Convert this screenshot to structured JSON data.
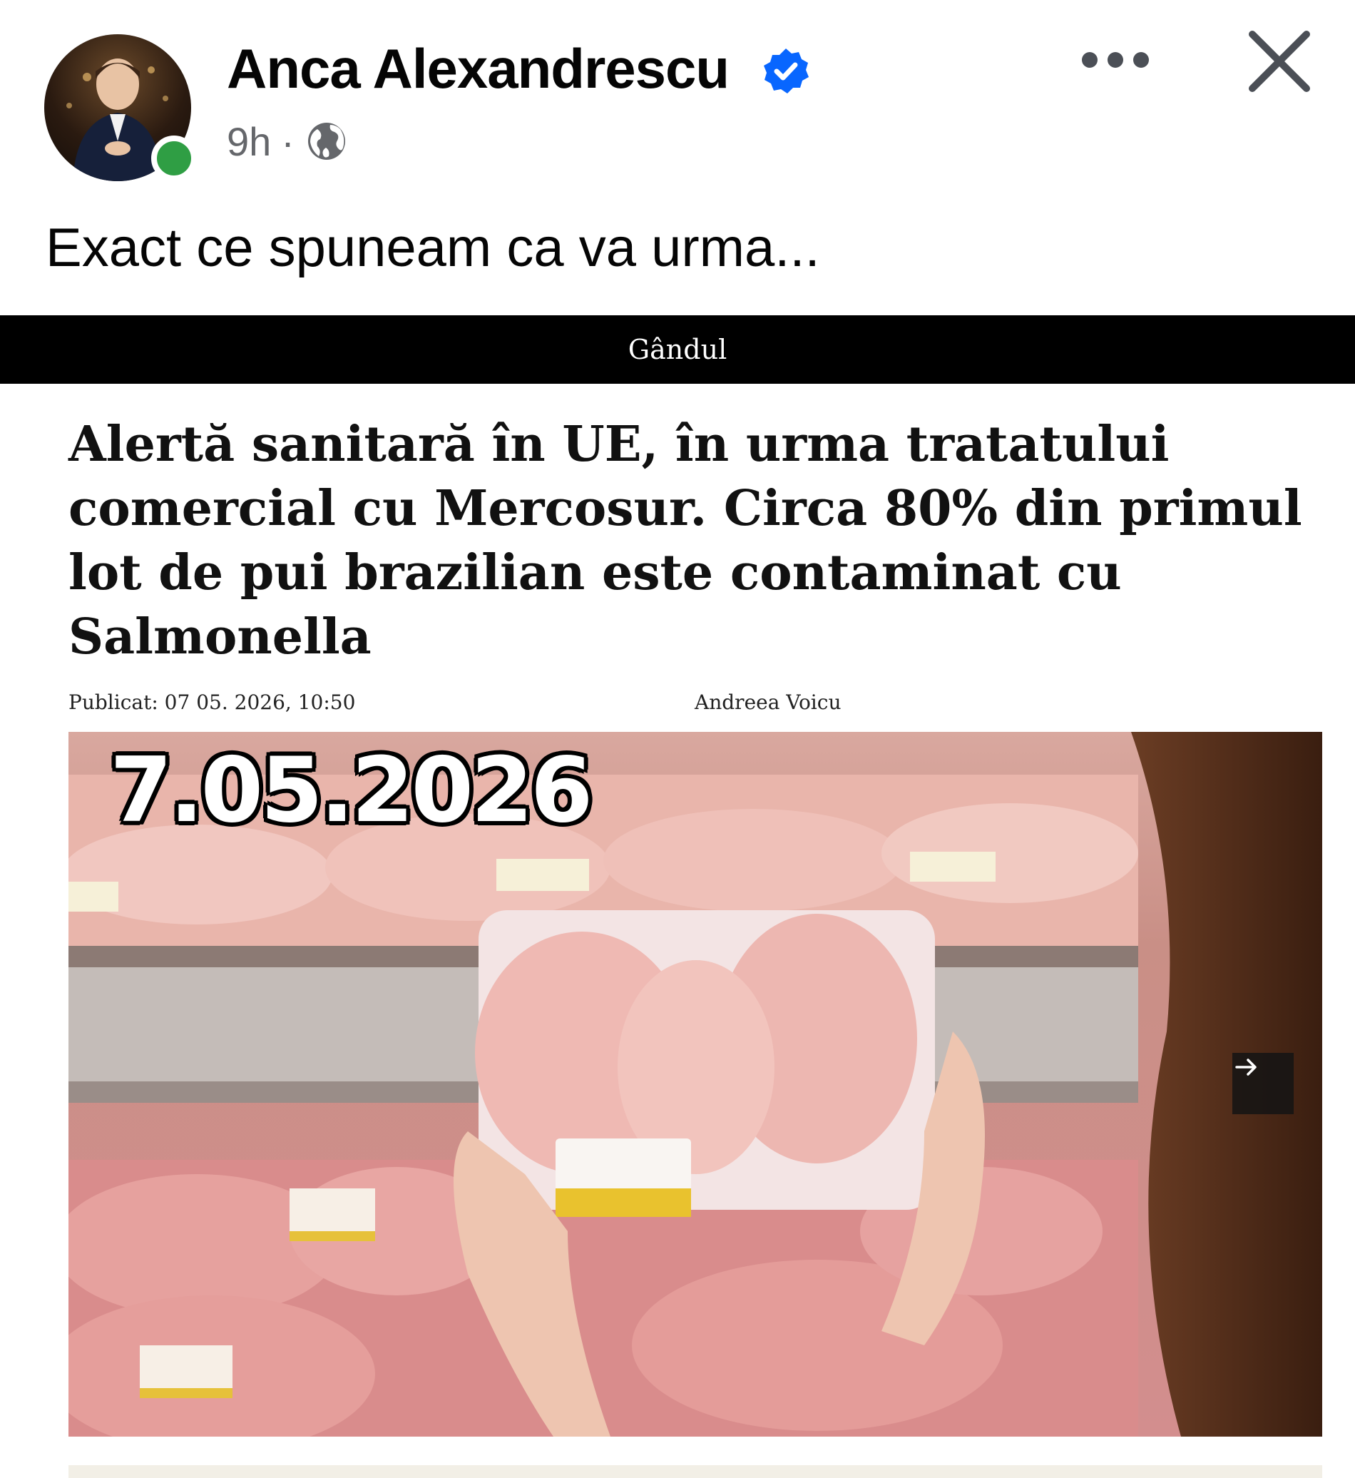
{
  "post": {
    "author_name": "Anca Alexandrescu",
    "time_ago": "9h",
    "separator": "·",
    "text": "Exact ce spuneam ca va urma..."
  },
  "icons": {
    "verified": "verified-badge-icon",
    "audience": "globe-icon",
    "more": "more-options-icon",
    "close": "close-icon",
    "next": "arrow-right-icon"
  },
  "article": {
    "source": "Gândul",
    "headline": "Alertă sanitară în UE, în urma tratatului comercial cu Mercosur. Circa 80% din primul lot de pui brazilian este contaminat cu Salmonella",
    "published": "Publicat: 07 05. 2026, 10:50",
    "author": "Andreea Voicu",
    "image_date_overlay": "7.05.2026"
  },
  "colors": {
    "verified_blue": "#0866ff",
    "online_green": "#2f9e44",
    "meta_gray": "#65676b",
    "source_bar": "#000000"
  }
}
